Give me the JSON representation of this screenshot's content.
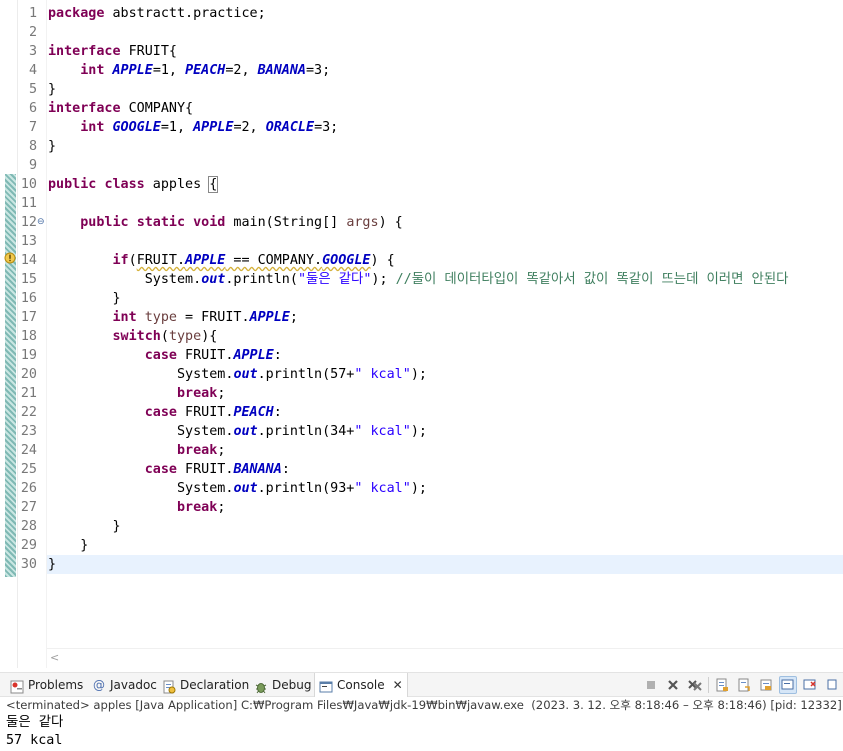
{
  "editor": {
    "lines": [
      {
        "n": "1",
        "html": "<span class=\"kw\">package</span> abstractt.practice;"
      },
      {
        "n": "2",
        "html": ""
      },
      {
        "n": "3",
        "html": "<span class=\"kw\">interface</span> FRUIT{"
      },
      {
        "n": "4",
        "html": "    <span class=\"kw\">int</span> <span class=\"cst\">APPLE</span>=1, <span class=\"cst\">PEACH</span>=2, <span class=\"cst\">BANANA</span>=3;"
      },
      {
        "n": "5",
        "html": "}"
      },
      {
        "n": "6",
        "html": "<span class=\"kw\">interface</span> COMPANY{"
      },
      {
        "n": "7",
        "html": "    <span class=\"kw\">int</span> <span class=\"cst\">GOOGLE</span>=1, <span class=\"cst\">APPLE</span>=2, <span class=\"cst\">ORACLE</span>=3;"
      },
      {
        "n": "8",
        "html": "}"
      },
      {
        "n": "9",
        "html": ""
      },
      {
        "n": "10",
        "html": "<span class=\"kw\">public</span> <span class=\"kw\">class</span> apples <span class=\"bracket-box\">{</span>"
      },
      {
        "n": "11",
        "html": ""
      },
      {
        "n": "12",
        "html": "    <span class=\"kw\">public</span> <span class=\"kw\">static</span> <span class=\"kw\">void</span> main(String[] <span class=\"par\">args</span>) {"
      },
      {
        "n": "13",
        "html": ""
      },
      {
        "n": "14",
        "html": "        <span class=\"kw\">if</span>(<span class=\"warn\">FRUIT.<span class=\"cst\">APPLE</span> == COMPANY.<span class=\"cst\">GOOGLE</span></span>) {"
      },
      {
        "n": "15",
        "html": "            System.<span class=\"cst\">out</span>.println(<span class=\"str\">\"둘은 같다\"</span>); <span class=\"cmt\">//둘이 데이터타입이 똑같아서 값이 똑같이 뜨는데 이러면 안된다</span>"
      },
      {
        "n": "16",
        "html": "        }"
      },
      {
        "n": "17",
        "html": "        <span class=\"kw\">int</span> <span class=\"par\">type</span> = FRUIT.<span class=\"cst\">APPLE</span>;"
      },
      {
        "n": "18",
        "html": "        <span class=\"kw\">switch</span>(<span class=\"par\">type</span>){"
      },
      {
        "n": "19",
        "html": "            <span class=\"kw\">case</span> FRUIT.<span class=\"cst\">APPLE</span>:"
      },
      {
        "n": "20",
        "html": "                System.<span class=\"cst\">out</span>.println(57+<span class=\"str\">\" kcal\"</span>);"
      },
      {
        "n": "21",
        "html": "                <span class=\"kw\">break</span>;"
      },
      {
        "n": "22",
        "html": "            <span class=\"kw\">case</span> FRUIT.<span class=\"cst\">PEACH</span>:"
      },
      {
        "n": "23",
        "html": "                System.<span class=\"cst\">out</span>.println(34+<span class=\"str\">\" kcal\"</span>);"
      },
      {
        "n": "24",
        "html": "                <span class=\"kw\">break</span>;"
      },
      {
        "n": "25",
        "html": "            <span class=\"kw\">case</span> FRUIT.<span class=\"cst\">BANANA</span>:"
      },
      {
        "n": "26",
        "html": "                System.<span class=\"cst\">out</span>.println(93+<span class=\"str\">\" kcal\"</span>);"
      },
      {
        "n": "27",
        "html": "                <span class=\"kw\">break</span>;"
      },
      {
        "n": "28",
        "html": "        }"
      },
      {
        "n": "29",
        "html": "    }"
      },
      {
        "n": "30",
        "html": "}"
      }
    ],
    "scroll_left_glyph": "<"
  },
  "tabs": {
    "problems": "Problems",
    "javadoc": "Javadoc",
    "declaration": "Declaration",
    "debug": "Debug",
    "console": "Console",
    "close": "✕"
  },
  "toolbar": {
    "icons": [
      "stop-icon",
      "remove-launch-icon",
      "remove-all-icon",
      "scroll-lock-icon",
      "word-wrap-icon",
      "show-on-output-icon",
      "pin-console-icon",
      "display-console-icon",
      "open-console-icon"
    ]
  },
  "console": {
    "status": "<terminated> apples [Java Application] C:₩Program Files₩Java₩jdk-19₩bin₩javaw.exe  (2023. 3. 12. 오후 8:18:46 – 오후 8:18:46) [pid: 12332]",
    "output": [
      "둘은 같다",
      "57 kcal"
    ]
  },
  "colors": {
    "keyword": "#7f0055",
    "constant": "#0000c0",
    "string": "#2a00ff",
    "comment": "#3f7f5f",
    "current_line": "#e8f2fe"
  }
}
